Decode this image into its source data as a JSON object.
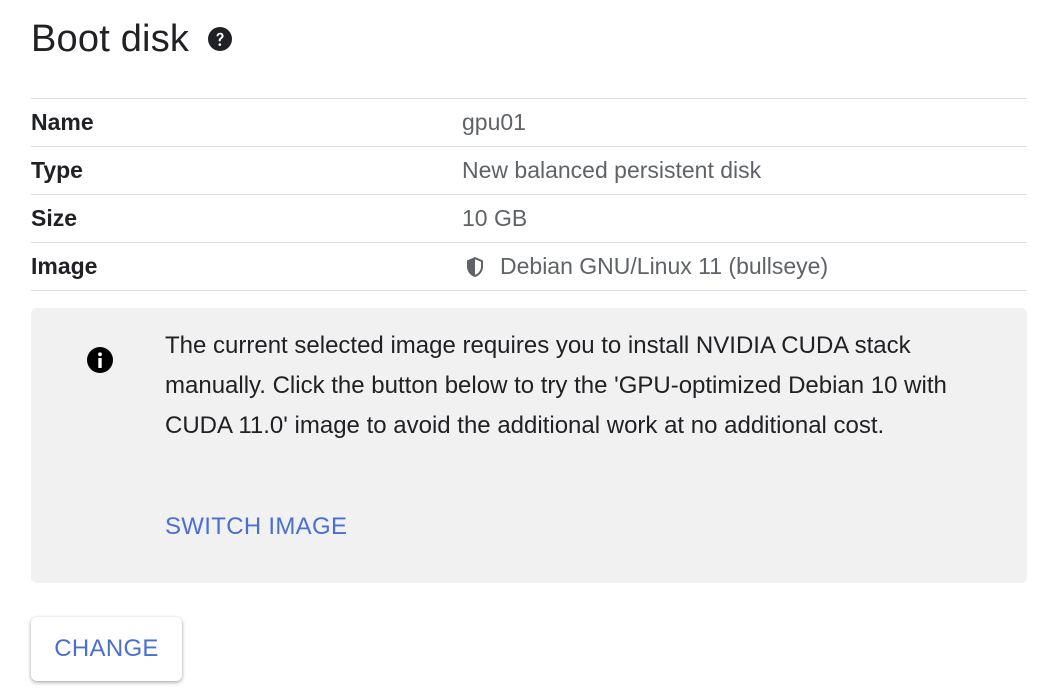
{
  "section": {
    "title": "Boot disk",
    "help_icon": "help-circle-icon"
  },
  "details": {
    "rows": [
      {
        "label": "Name",
        "value": "gpu01"
      },
      {
        "label": "Type",
        "value": "New balanced persistent disk"
      },
      {
        "label": "Size",
        "value": "10 GB"
      },
      {
        "label": "Image",
        "value": "Debian GNU/Linux 11 (bullseye)",
        "icon": "shield-icon"
      }
    ]
  },
  "notice": {
    "icon": "info-icon",
    "message": "The current selected image requires you to install NVIDIA CUDA stack manually. Click the button below to try the 'GPU-optimized Debian 10 with CUDA 11.0' image to avoid the additional work at no additional cost.",
    "action_label": "SWITCH IMAGE"
  },
  "actions": {
    "change_label": "CHANGE"
  },
  "colors": {
    "accent": "#4a6fd0",
    "notice_background": "#f1f1f1",
    "divider": "#dadce0",
    "secondary_text": "#5f6368"
  }
}
